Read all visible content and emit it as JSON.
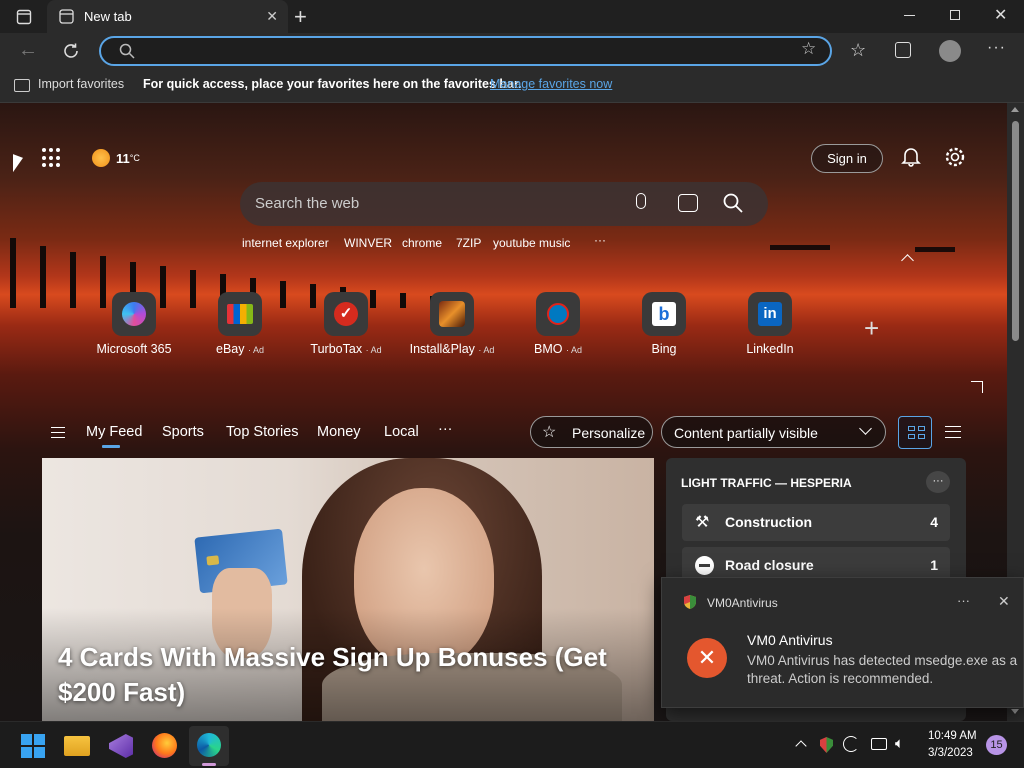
{
  "browser": {
    "tab_title": "New tab",
    "address_value": "",
    "favorites_bar": {
      "import_label": "Import favorites",
      "message": "For quick access, place your favorites here on the favorites bar.",
      "manage_link": "Manage favorites now"
    }
  },
  "newtab": {
    "weather": {
      "temp": "11",
      "unit": "°C"
    },
    "sign_in_label": "Sign in",
    "search": {
      "placeholder": "Search the web"
    },
    "suggestions": [
      "internet explorer",
      "WINVER",
      "chrome",
      "7ZIP",
      "youtube music"
    ],
    "more_glyph": "···",
    "add_glyph": "+",
    "quick_links": [
      {
        "label": "Microsoft 365",
        "ad": "",
        "icon": "microsoft-365-icon"
      },
      {
        "label": "eBay",
        "ad": "· Ad",
        "icon": "ebay-icon"
      },
      {
        "label": "TurboTax",
        "ad": "· Ad",
        "icon": "turbotax-icon"
      },
      {
        "label": "Install&Play",
        "ad": "· Ad",
        "icon": "install-play-icon"
      },
      {
        "label": "BMO",
        "ad": "· Ad",
        "icon": "bmo-icon"
      },
      {
        "label": "Bing",
        "ad": "",
        "icon": "bing-icon"
      },
      {
        "label": "LinkedIn",
        "ad": "",
        "icon": "linkedin-icon"
      }
    ],
    "feed_nav": {
      "items": [
        "My Feed",
        "Sports",
        "Top Stories",
        "Money",
        "Local"
      ],
      "more": "···",
      "personalize_label": "Personalize",
      "visibility_value": "Content partially visible"
    },
    "hero_card": {
      "headline": "4 Cards With Massive Sign Up Bonuses (Get $200 Fast)"
    },
    "traffic": {
      "title": "LIGHT TRAFFIC — HESPERIA",
      "rows": [
        {
          "label": "Construction",
          "count": "4"
        },
        {
          "label": "Road closure",
          "count": "1"
        }
      ]
    }
  },
  "notification": {
    "app": "VM0Antivirus",
    "title": "VM0 Antivirus",
    "body": "VM0 Antivirus has detected msedge.exe as a threat. Action is recommended.",
    "more": "···"
  },
  "taskbar": {
    "time": "10:49 AM",
    "date": "3/3/2023",
    "badge": "15"
  },
  "colors": {
    "accent": "#5aa5e6",
    "alert": "#e4572e",
    "link": "#5aa5e6"
  }
}
